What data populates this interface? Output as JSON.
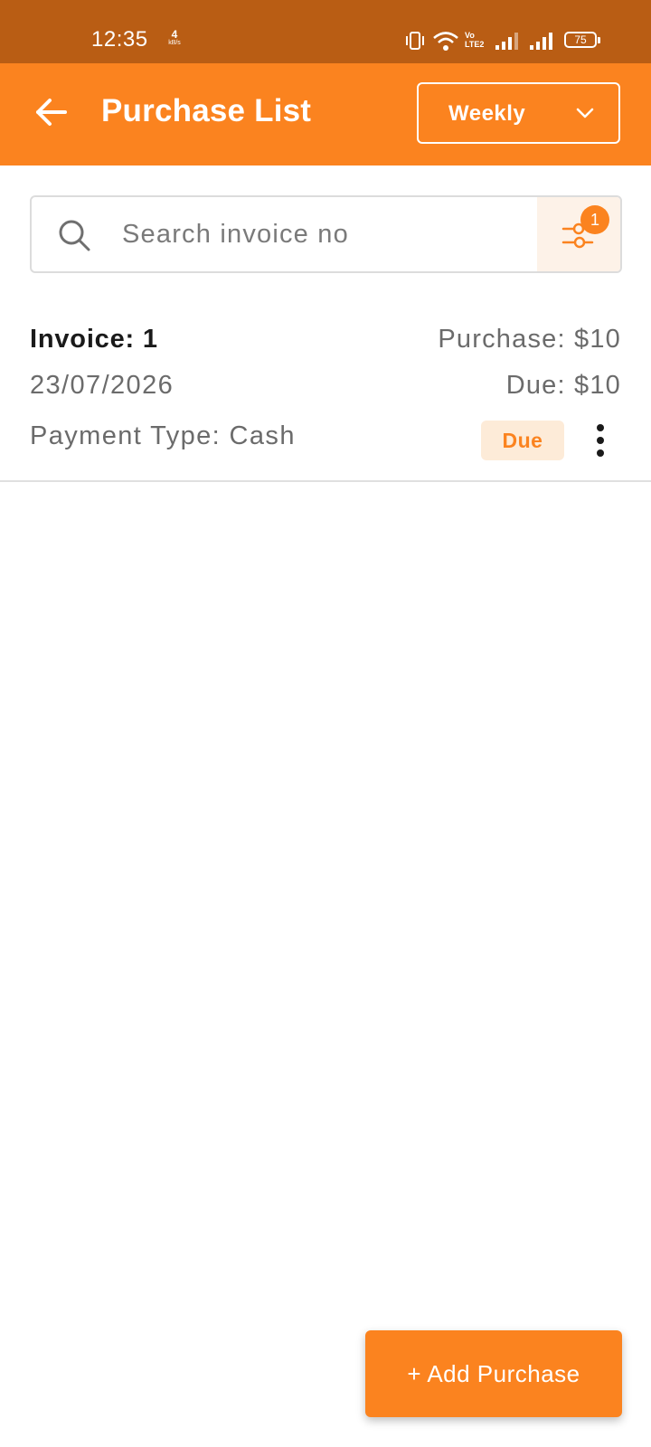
{
  "status_bar": {
    "time": "12:35",
    "net_speed_value": "4",
    "net_speed_unit": "kB/s",
    "volte_label_top": "Vo",
    "volte_label_bottom": "LTE2",
    "battery_level": "75"
  },
  "app_bar": {
    "title": "Purchase List",
    "period_select": {
      "selected": "Weekly"
    }
  },
  "search": {
    "placeholder": "Search invoice no",
    "value": "",
    "filter_count": "1"
  },
  "invoices": [
    {
      "title": "Invoice: 1",
      "date": "23/07/2026",
      "payment_type": "Payment Type: Cash",
      "purchase": "Purchase: $10",
      "due": "Due: $10",
      "status": "Due"
    }
  ],
  "fab": {
    "label": "+ Add Purchase"
  },
  "colors": {
    "accent": "#fb831f",
    "status_bar": "#b95d14",
    "badge_bg": "#fdebd8",
    "filter_bg": "#fdf2e8"
  }
}
